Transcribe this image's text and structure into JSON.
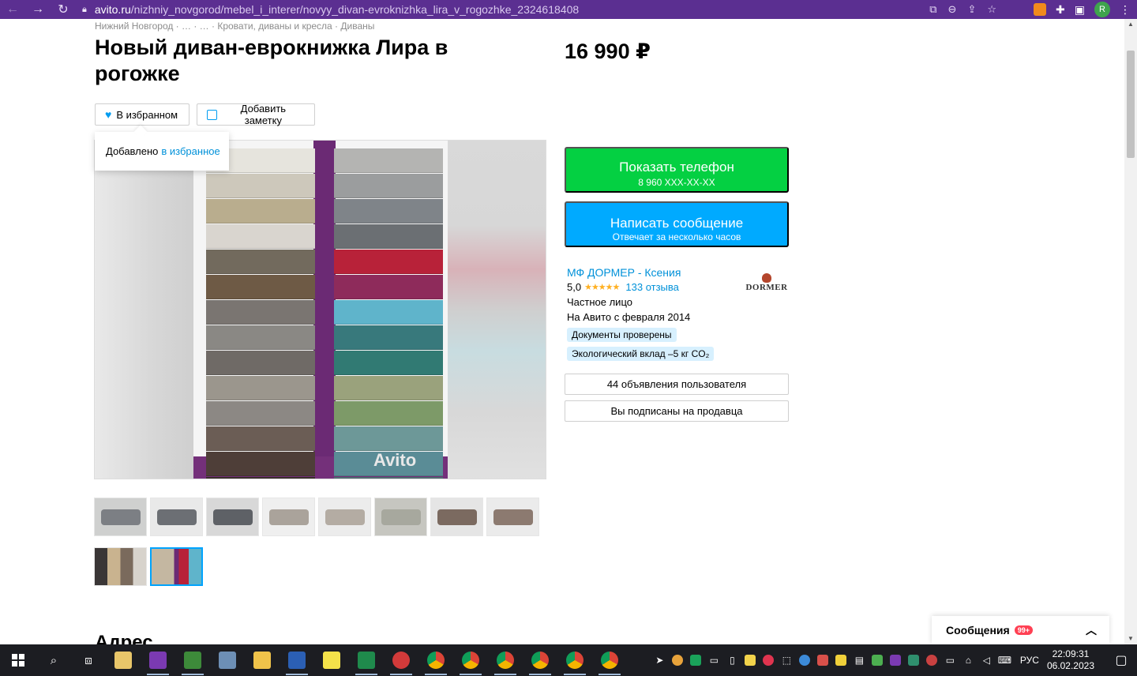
{
  "browser": {
    "url_host": "avito.ru",
    "url_path": "/nizhniy_novgorod/mebel_i_interer/novyy_divan-evroknizhka_lira_v_rogozhke_2324618408",
    "profile_initial": "R"
  },
  "listing": {
    "breadcrumb": "Нижний Новгород · … · … · Кровати, диваны и кресла · Диваны",
    "title": "Новый диван-еврокнижка Лира в рогожке",
    "price": "16 990 ₽",
    "favorite_label": "В избранном",
    "note_label": "Добавить заметку",
    "tooltip_text": "Добавлено",
    "tooltip_link": "в избранное",
    "watermark": "Avito",
    "section_title": "Адрес"
  },
  "actions": {
    "show_phone": "Показать телефон",
    "phone_masked": "8 960 XXX-XX-XX",
    "write_message": "Написать сообщение",
    "response_time": "Отвечает за несколько часов"
  },
  "seller": {
    "name": "МФ ДОРМЕР - Ксения",
    "rating": "5,0",
    "stars": "★★★★★",
    "reviews": "133 отзыва",
    "type": "Частное лицо",
    "since": "На Авито с февраля 2014",
    "badge_docs": "Документы проверены",
    "badge_eco": "Экологический вклад –5 кг CO₂",
    "logo_text": "DORMER",
    "listings_button": "44 объявления пользователя",
    "subscribed_button": "Вы подписаны на продавца"
  },
  "messages": {
    "label": "Сообщения",
    "count": "99+"
  },
  "taskbar": {
    "language": "РУС",
    "time": "22:09:31",
    "date": "06.02.2023"
  },
  "swatches": {
    "left": [
      "#e6e4dd",
      "#cdc8bb",
      "#b9ad8e",
      "#d9d5cf",
      "#726a5d",
      "#6e5a45",
      "#7a7571",
      "#8a8884",
      "#6f6a66",
      "#9b968d",
      "#8c8884",
      "#6b5d55",
      "#4e3e38",
      "#3a2e2b"
    ],
    "right": [
      "#b4b4b2",
      "#9b9d9e",
      "#7f8489",
      "#6b6f73",
      "#b82239",
      "#8e2b5b",
      "#5fb4cb",
      "#38797c",
      "#317a73",
      "#9aa27c",
      "#7d9a68",
      "#6d9898",
      "#5a8c96",
      "#4f6a70"
    ]
  }
}
